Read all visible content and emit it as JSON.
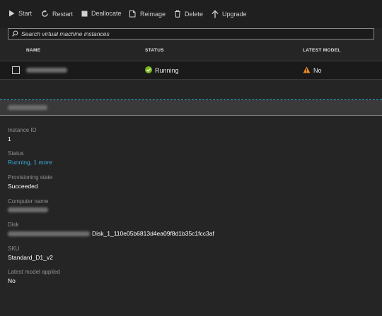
{
  "toolbar": {
    "start": "Start",
    "restart": "Restart",
    "deallocate": "Deallocate",
    "reimage": "Reimage",
    "delete": "Delete",
    "upgrade": "Upgrade"
  },
  "search": {
    "placeholder": "Search virtual machine instances"
  },
  "table": {
    "headers": {
      "name": "NAME",
      "status": "STATUS",
      "latest_model": "LATEST MODEL"
    },
    "rows": [
      {
        "status": "Running",
        "latest_model": "No"
      }
    ]
  },
  "details": {
    "instance_id": {
      "label": "Instance ID",
      "value": "1"
    },
    "status": {
      "label": "Status",
      "value": "Running, 1 more"
    },
    "provisioning_state": {
      "label": "Provisioning state",
      "value": "Succeeded"
    },
    "computer_name": {
      "label": "Computer name"
    },
    "disk": {
      "label": "Disk",
      "value_suffix": "Disk_1_110e05b6813d4ea09f8d1b35c1fcc3af"
    },
    "sku": {
      "label": "SKU",
      "value": "Standard_D1_v2"
    },
    "latest_model_applied": {
      "label": "Latest model applied",
      "value": "No"
    }
  },
  "colors": {
    "background": "#252526",
    "toolbar": "#1f1f1f",
    "link": "#3aa9d8",
    "success": "#7ab51d",
    "warning": "#f08a24",
    "accent_divider": "#3aa9c9"
  },
  "icons": [
    "play-icon",
    "restart-icon",
    "stop-icon",
    "reimage-icon",
    "trash-icon",
    "upgrade-arrow-icon",
    "search-icon",
    "checkmark-circle-icon",
    "warning-icon"
  ]
}
